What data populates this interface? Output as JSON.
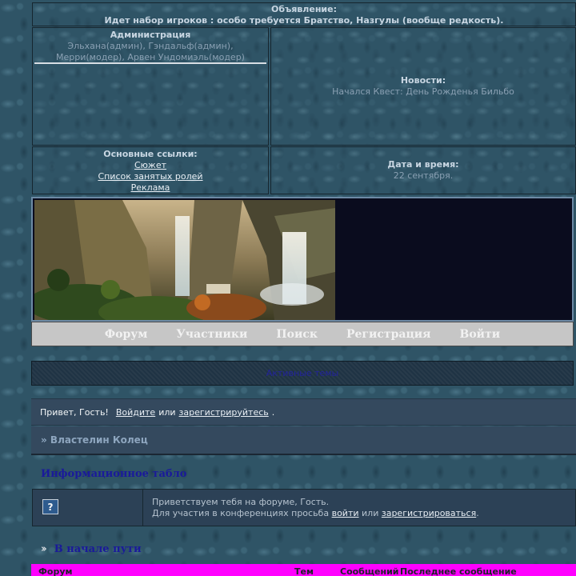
{
  "announcement": {
    "title": "Объявление:",
    "text": "Идет набор игроков : особо требуется Братство, Назгулы (вообще редкость)."
  },
  "administration": {
    "title": "Администрация",
    "text": "Эльхана(админ), Гэндальф(админ), Мерри(модер), Арвен Ундомиэль(модер)"
  },
  "news": {
    "title": "Новости:",
    "text": "Начался Квест: День Рожденья Бильбо"
  },
  "main_links": {
    "title": "Основные ссылки:",
    "items": [
      "Сюжет",
      "Список занятых ролей",
      "Реклама"
    ]
  },
  "datetime": {
    "title": "Дата и время:",
    "text": "22 сентября."
  },
  "nav": {
    "items": [
      "Форум",
      "Участники",
      "Поиск",
      "Регистрация",
      "Войти"
    ]
  },
  "active_topics": "Активные темы",
  "greeting": {
    "hello": "Привет, Гость!",
    "login_link": "Войдите",
    "or": "или",
    "register_link": "зарегистрируйтесь",
    "end": "."
  },
  "forum_title": "» Властелин Колец",
  "info_board": {
    "title": "Информационное табло",
    "icon": "question-icon",
    "line1": "Приветствуем тебя на форуме, Гость.",
    "line2_prefix": "Для участия в конференциях просьба",
    "login_link": "войти",
    "or": "или",
    "register_link": "зарегистрироваться",
    "end": "."
  },
  "category": {
    "arrows_icon": "double-chevron-icon",
    "title": "В начале пути"
  },
  "table_header": {
    "forum": "Форум",
    "topics": "Тем",
    "posts": "Сообщений",
    "last_post": "Последнее сообщение",
    "color": "#ff00ff"
  }
}
